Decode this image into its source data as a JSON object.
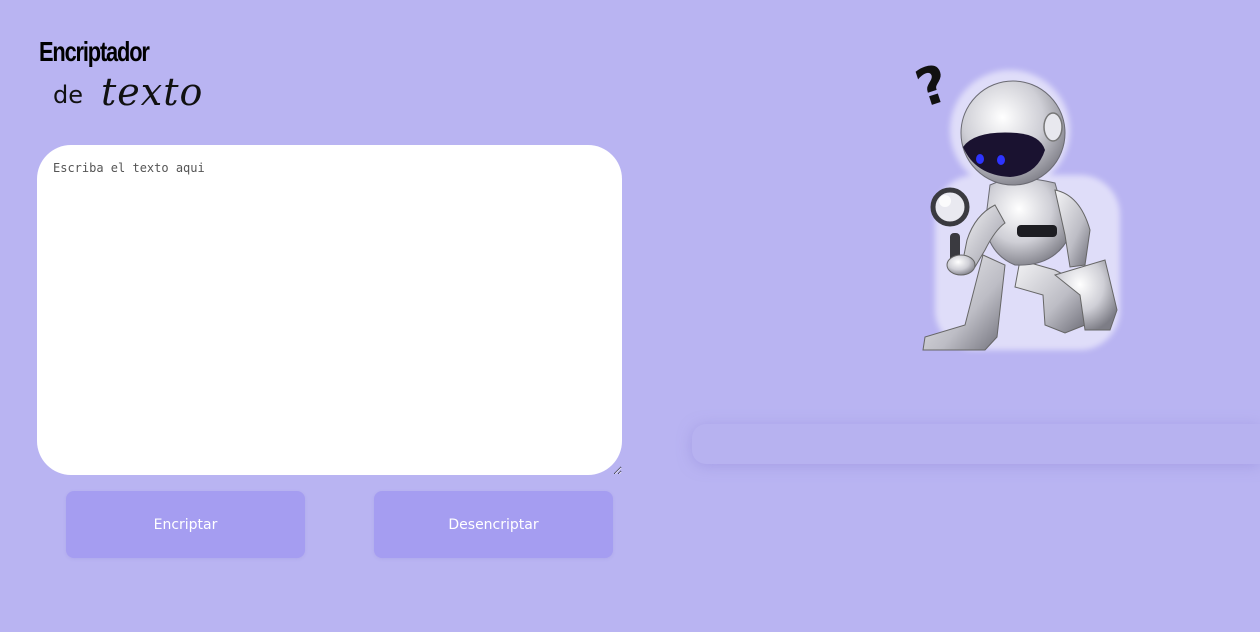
{
  "logo": {
    "title": "Encriptador",
    "de": "de",
    "texto": "texto"
  },
  "input": {
    "placeholder": "Escriba el texto aqui",
    "value": ""
  },
  "buttons": {
    "encrypt_label": "Encriptar",
    "decrypt_label": "Desencriptar"
  },
  "illustration": {
    "icon": "robot-with-magnifying-glass-icon"
  },
  "colors": {
    "background": "#b9b4f2",
    "button": "#a59df1",
    "input_background": "#ffffff"
  }
}
